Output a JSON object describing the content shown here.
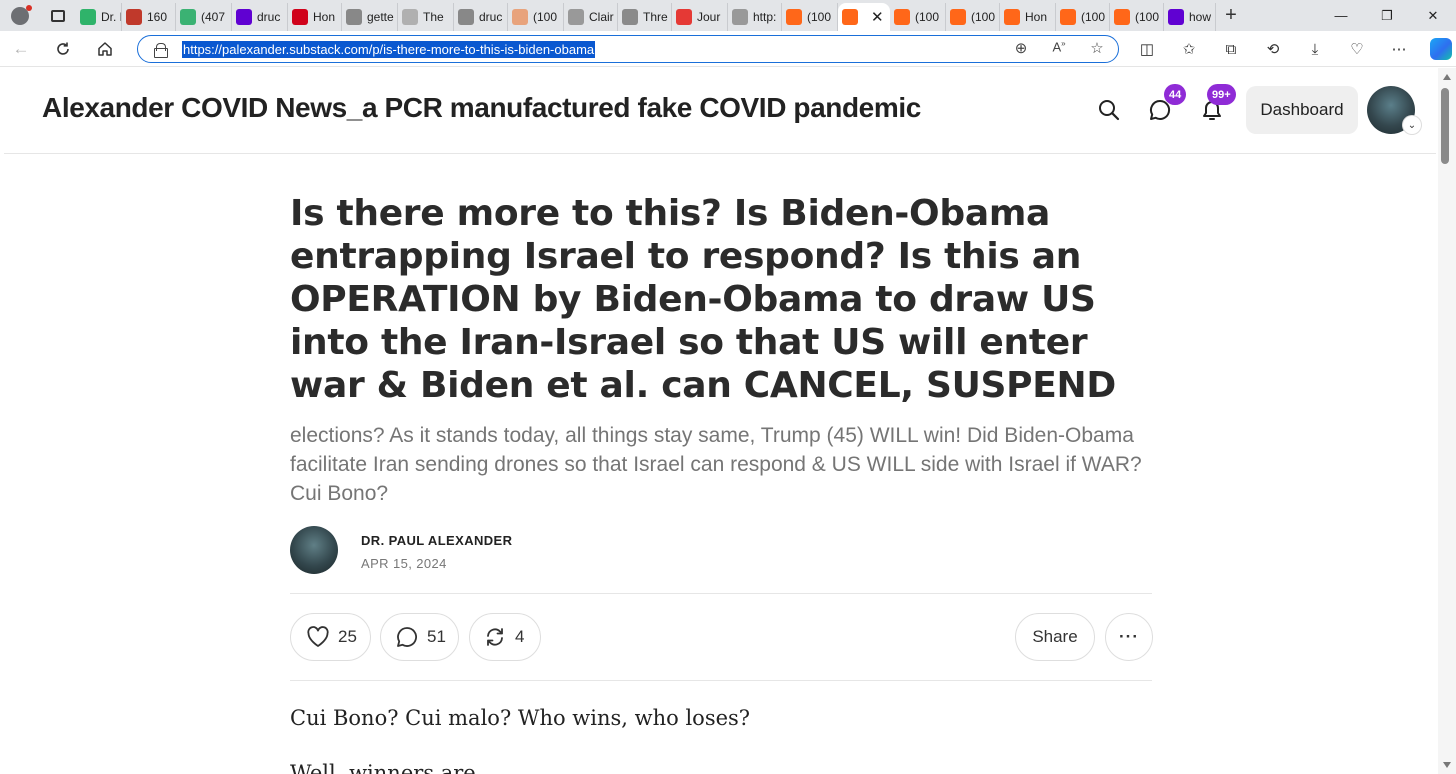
{
  "browser": {
    "tabs": [
      {
        "label": "Dr. N",
        "icon": "video-play-icon",
        "color": "#2fb36a"
      },
      {
        "label": "160",
        "icon": "bi-icon",
        "color": "#c0392b"
      },
      {
        "label": "(407",
        "icon": "g-icon",
        "color": "#3bb273"
      },
      {
        "label": "druc",
        "icon": "yahoo-icon",
        "color": "#6001d2"
      },
      {
        "label": "Hon",
        "icon": "news-icon",
        "color": "#d0021b"
      },
      {
        "label": "gette",
        "icon": "search-icon",
        "color": "#888888"
      },
      {
        "label": "The",
        "icon": "flag-icon",
        "color": "#b0b0b0"
      },
      {
        "label": "druc",
        "icon": "document-search-icon",
        "color": "#888888"
      },
      {
        "label": "(100",
        "icon": "substack-icon",
        "color": "#e8a37c"
      },
      {
        "label": "Clair",
        "icon": "page-icon",
        "color": "#999999"
      },
      {
        "label": "Thre",
        "icon": "tt-icon",
        "color": "#8a8a8a"
      },
      {
        "label": "Jour",
        "icon": "youtube-icon",
        "color": "#e53935"
      },
      {
        "label": "http:",
        "icon": "page-icon",
        "color": "#999999"
      },
      {
        "label": "(100",
        "icon": "substack-icon",
        "color": "#ff6719"
      },
      {
        "label": "",
        "icon": "substack-icon",
        "color": "#ff6719",
        "active": true
      },
      {
        "label": "(100",
        "icon": "substack-icon",
        "color": "#ff6719"
      },
      {
        "label": "(100",
        "icon": "substack-icon",
        "color": "#ff6719"
      },
      {
        "label": "Hon",
        "icon": "substack-icon",
        "color": "#ff6719"
      },
      {
        "label": "(100",
        "icon": "substack-icon",
        "color": "#ff6719"
      },
      {
        "label": "(100",
        "icon": "substack-icon",
        "color": "#ff6719"
      },
      {
        "label": "how",
        "icon": "yahoo-icon",
        "color": "#6001d2"
      }
    ],
    "url": "https://palexander.substack.com/p/is-there-more-to-this-is-biden-obama"
  },
  "site": {
    "title": "Alexander COVID News_a PCR manufactured fake COVID pandemic",
    "messages_badge": "44",
    "notifications_badge": "99+",
    "dashboard_label": "Dashboard"
  },
  "post": {
    "headline": "Is there more to this? Is Biden-Obama entrapping Israel to respond? Is this an OPERATION by Biden-Obama to draw US into the Iran-Israel so that US will enter war & Biden et al. can CANCEL, SUSPEND",
    "subtitle": "elections? As it stands today, all things stay same, Trump (45) WILL win! Did Biden-Obama facilitate Iran sending drones so that Israel can respond & US WILL side with Israel if WAR? Cui Bono?",
    "author": "DR. PAUL ALEXANDER",
    "date": "APR 15, 2024",
    "likes": "25",
    "comments": "51",
    "restacks": "4",
    "share_label": "Share",
    "body": [
      "Cui Bono? Cui malo? Who wins, who loses?",
      "Well, winners are"
    ]
  },
  "colors": {
    "accent_badge": "#8f2bd6",
    "substack_orange": "#ff6719",
    "url_highlight": "#0a58d0"
  }
}
